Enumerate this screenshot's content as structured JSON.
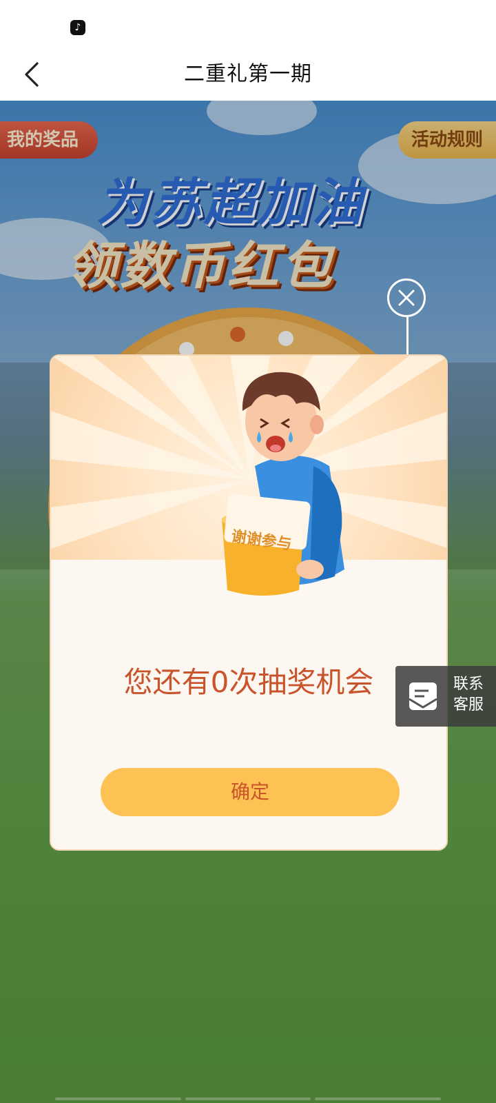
{
  "status_bar": {
    "app_icon": "tiktok-icon"
  },
  "nav": {
    "back_icon": "chevron-left-icon",
    "title": "二重礼第一期"
  },
  "activity": {
    "headline_line1": "为苏超加油",
    "headline_line2": "领数币红包",
    "my_prizes_label": "我的奖品",
    "rules_label": "活动规则"
  },
  "dialog": {
    "card_label": "谢谢参与",
    "message": "您还有0次抽奖机会",
    "confirm_label": "确定",
    "close_icon": "close-icon"
  },
  "service": {
    "label": "联系客服",
    "icon": "mail-icon"
  },
  "colors": {
    "accent_orange": "#c9542b",
    "button_yellow": "#fdc253",
    "prize_tab_red": "#d9503c",
    "rules_tab_gold": "#f0c462"
  }
}
